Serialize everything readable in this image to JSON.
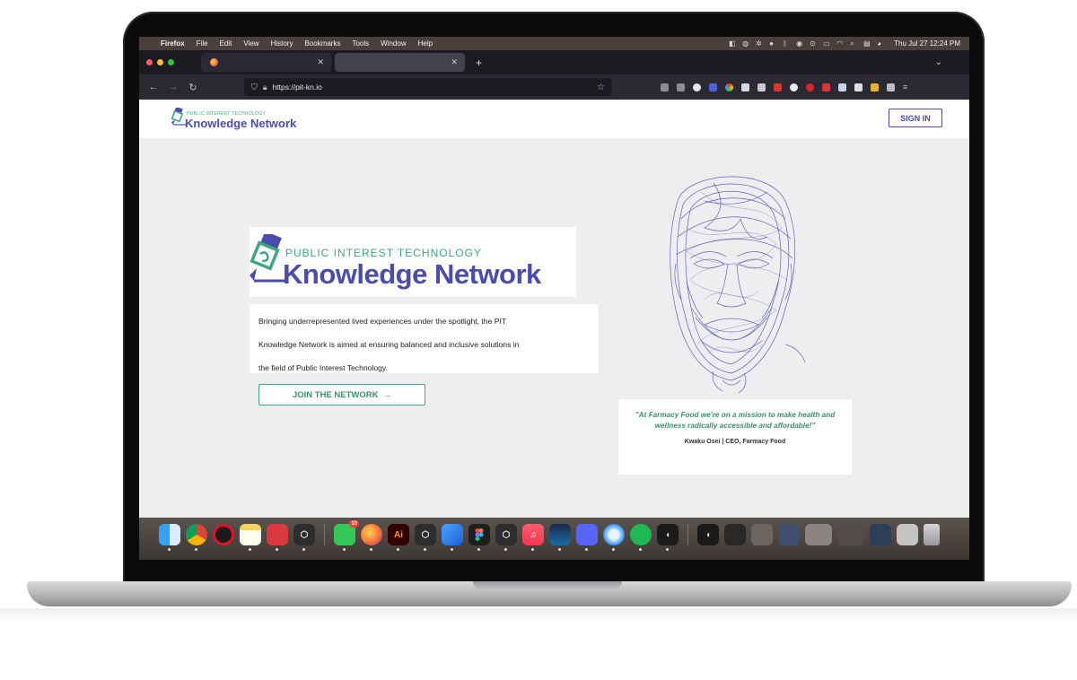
{
  "menubar": {
    "app": "Firefox",
    "items": [
      "File",
      "Edit",
      "View",
      "History",
      "Bookmarks",
      "Tools",
      "Window",
      "Help"
    ],
    "clock": "Thu Jul 27  12:24 PM"
  },
  "tabs": [
    {
      "title": "",
      "active": false
    },
    {
      "title": "",
      "active": true
    }
  ],
  "browser": {
    "url": "https://pit-kn.io"
  },
  "site": {
    "logo_top": "PUBLIC INTEREST TECHNOLOGY",
    "logo_main": "Knowledge Network",
    "sign_in": "SIGN IN",
    "hero_top": "PUBLIC INTEREST TECHNOLOGY",
    "hero_main": "Knowledge Network",
    "hero_line1": "Bringing underrepresented lived experiences under the spotlight, the PIT",
    "hero_line2": "Knowledge Network is aimed at ensuring balanced and inclusive solutions in",
    "hero_line3": "the field of Public Interest Technology.",
    "join": "JOIN THE NETWORK",
    "join_arrow": "→",
    "quote": "\"At Farmacy Food we're on a mission to make health and wellness radically accessible and affordable!\"",
    "quote_author": "Kwaku Osei | CEO, Farmacy Food"
  },
  "colors": {
    "brand_blue": "#4a4cae",
    "brand_green": "#3fa783"
  },
  "dock": {
    "apps": [
      "finder",
      "chrome",
      "opera",
      "notes",
      "expressvpn",
      "unity",
      "messages",
      "firefox",
      "illustrator",
      "unity-hub",
      "xcode",
      "figma",
      "unity-2",
      "music",
      "steam",
      "discord",
      "safari",
      "spotify",
      "cursor",
      "cursor-2"
    ],
    "messages_badge": "10"
  }
}
